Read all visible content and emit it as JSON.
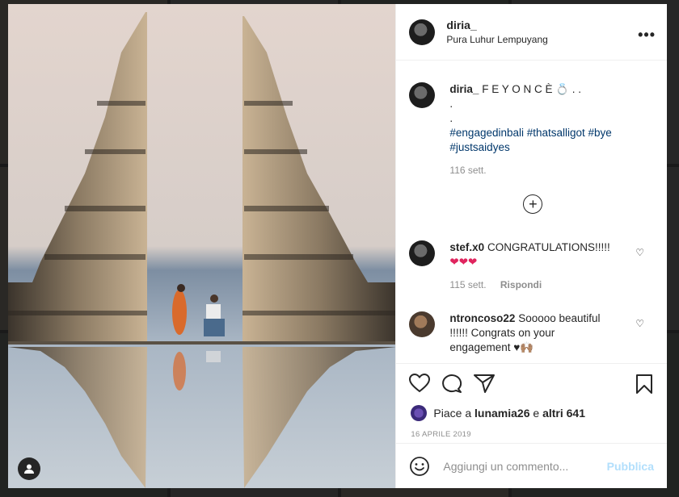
{
  "post": {
    "username": "diria_",
    "location": "Pura Luhur Lempuyang",
    "caption_user": "diria_",
    "caption_text": "F E Y O N C È 💍 . .",
    "caption_dot1": ".",
    "caption_dot2": ".",
    "hashtags_line1": "#engagedinbali #thatsalligot #bye",
    "hashtags_line2": "#justsaidyes",
    "caption_age": "116 sett."
  },
  "comments": [
    {
      "user": "stef.x0",
      "text": "CONGRATULATIONS!!!!!",
      "line2": "❤❤❤",
      "age": "115 sett.",
      "reply": "Rispondi"
    },
    {
      "user": "ntroncoso22",
      "text": "Sooooo beautiful",
      "line2": "!!!!!! Congrats on your",
      "line3": "engagement ♥🙌🏽"
    }
  ],
  "likes": {
    "prefix": "Piace a ",
    "user": "lunamia26",
    "middle": " e ",
    "others": "altri 641"
  },
  "date": "16 APRILE 2019",
  "add_comment": {
    "placeholder": "Aggiungi un commento...",
    "publish": "Pubblica"
  },
  "icons": {
    "more": "more-options-icon",
    "heart": "heart-icon",
    "comment": "comment-icon",
    "share": "share-icon",
    "save": "bookmark-icon",
    "emoji": "emoji-icon",
    "plus": "load-more-icon"
  }
}
